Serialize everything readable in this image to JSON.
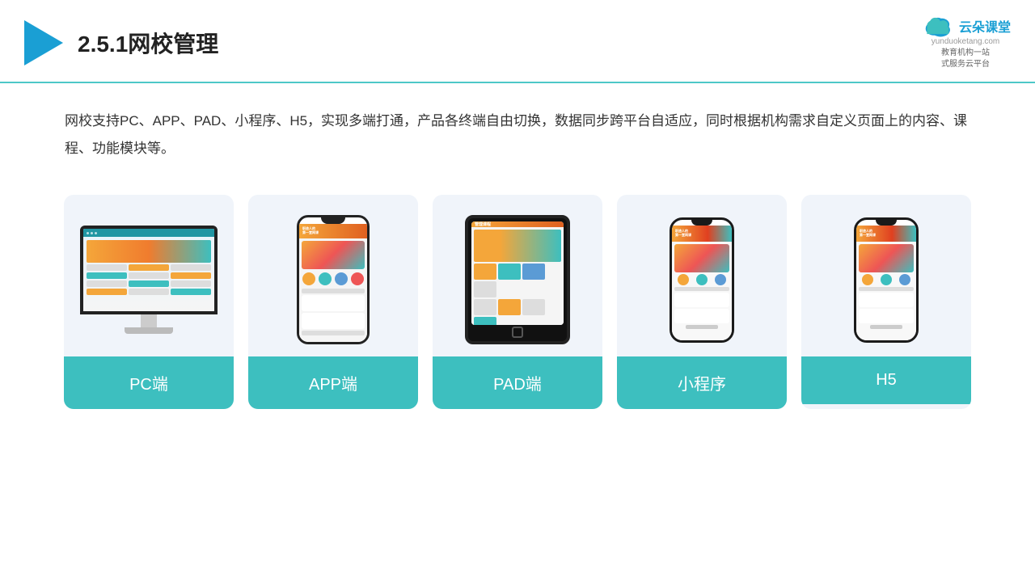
{
  "header": {
    "title": "2.5.1网校管理",
    "brand_name": "云朵课堂",
    "brand_url": "yunduoketang.com",
    "brand_tagline": "教育机构一站\n式服务云平台"
  },
  "description": {
    "text": "网校支持PC、APP、PAD、小程序、H5，实现多端打通，产品各终端自由切换，数据同步跨平台自适应，同时根据机构需求自定义页面上的内容、课程、功能模块等。"
  },
  "cards": [
    {
      "label": "PC端",
      "type": "pc"
    },
    {
      "label": "APP端",
      "type": "phone"
    },
    {
      "label": "PAD端",
      "type": "tablet"
    },
    {
      "label": "小程序",
      "type": "miniphone"
    },
    {
      "label": "H5",
      "type": "miniphone2"
    }
  ],
  "colors": {
    "accent": "#3dbfbf",
    "header_line": "#4dc8c8",
    "triangle": "#1a9fd4",
    "title": "#222222",
    "text": "#333333",
    "brand": "#1a9fd4"
  }
}
